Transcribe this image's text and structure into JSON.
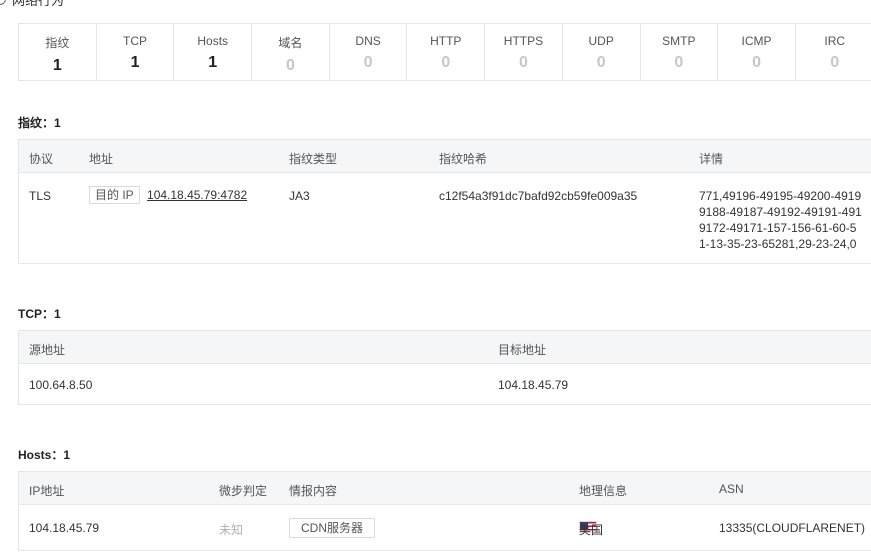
{
  "top": {
    "title": "网络行为"
  },
  "stats": [
    {
      "label": "指纹",
      "value": "1"
    },
    {
      "label": "TCP",
      "value": "1"
    },
    {
      "label": "Hosts",
      "value": "1"
    },
    {
      "label": "域名",
      "value": "0"
    },
    {
      "label": "DNS",
      "value": "0"
    },
    {
      "label": "HTTP",
      "value": "0"
    },
    {
      "label": "HTTPS",
      "value": "0"
    },
    {
      "label": "UDP",
      "value": "0"
    },
    {
      "label": "SMTP",
      "value": "0"
    },
    {
      "label": "ICMP",
      "value": "0"
    },
    {
      "label": "IRC",
      "value": "0"
    }
  ],
  "fingerprint": {
    "section_title": "指纹：1",
    "headers": {
      "protocol": "协议",
      "address": "地址",
      "type": "指纹类型",
      "hash": "指纹哈希",
      "details": "详情"
    },
    "row": {
      "protocol": "TLS",
      "address_tag": "目的 IP",
      "address": "104.18.45.79:4782",
      "type": "JA3",
      "hash": "c12f54a3f91dc7bafd92cb59fe009a35",
      "details_lines": [
        "771,49196-49195-49200-4919",
        "9188-49187-49192-49191-491",
        "9172-49171-157-156-61-60-5",
        "1-13-35-23-65281,29-23-24,0"
      ]
    }
  },
  "tcp": {
    "section_title": "TCP：1",
    "headers": {
      "src": "源地址",
      "dst": "目标地址"
    },
    "row": {
      "src": "100.64.8.50",
      "dst": "104.18.45.79"
    }
  },
  "hosts": {
    "section_title": "Hosts：1",
    "headers": {
      "ip": "IP地址",
      "judgement": "微步判定",
      "intel": "情报内容",
      "geo": "地理信息",
      "asn": "ASN"
    },
    "row": {
      "ip": "104.18.45.79",
      "judgement": "未知",
      "intel": "CDN服务器",
      "geo": "美国",
      "asn": "13335(CLOUDFLARENET)"
    }
  }
}
